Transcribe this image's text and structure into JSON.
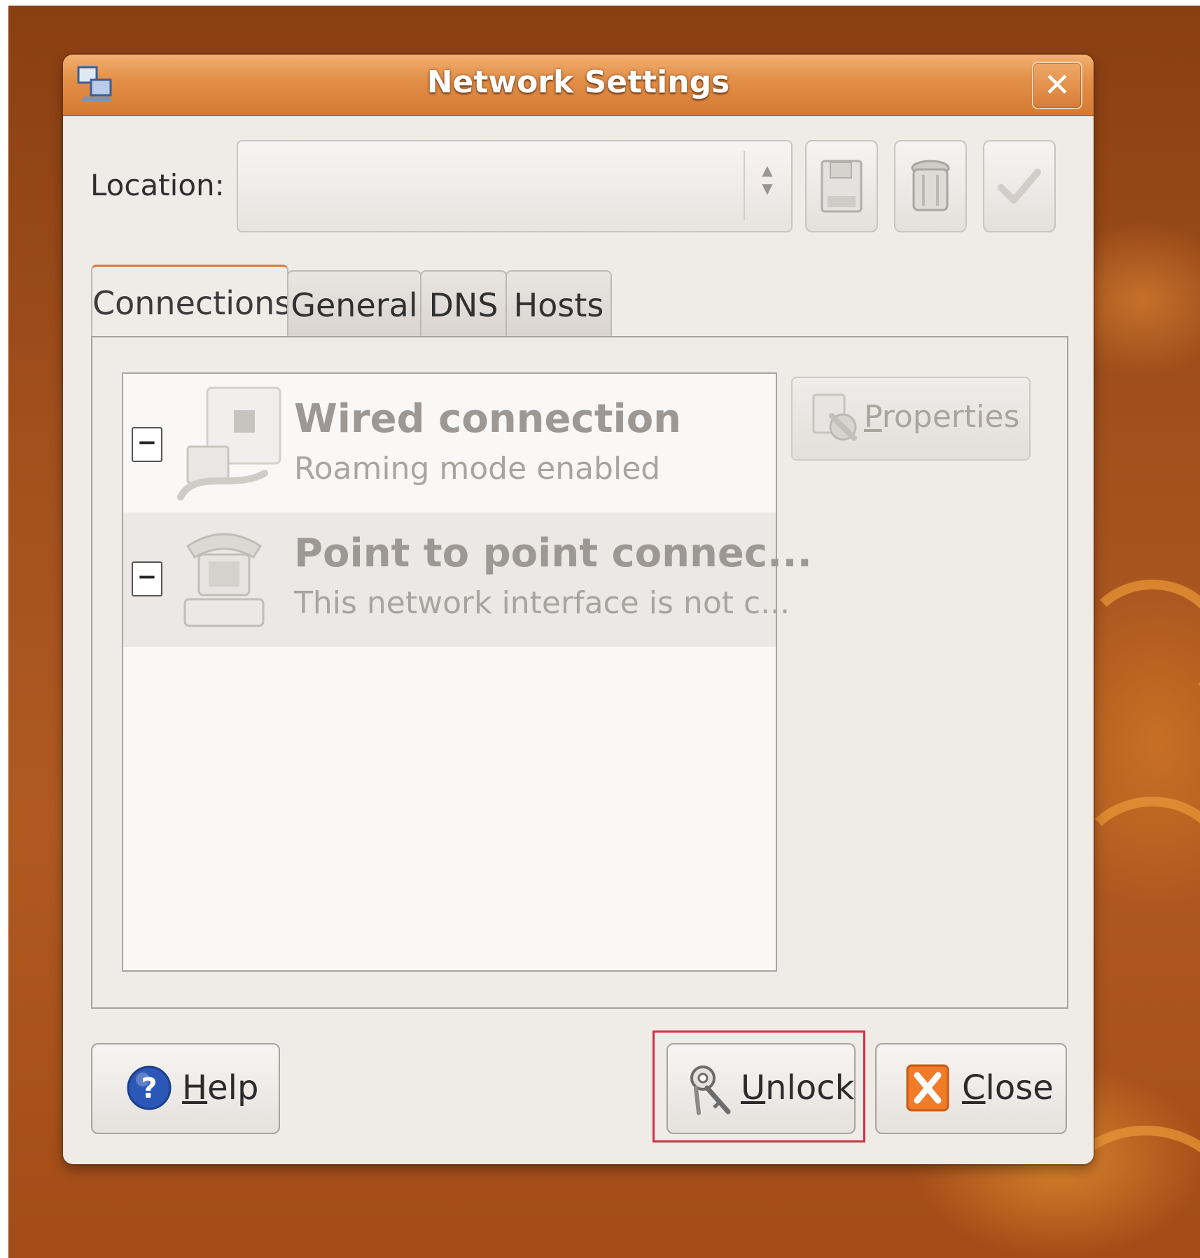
{
  "window": {
    "title": "Network Settings",
    "close_symbol": "✕"
  },
  "location": {
    "label": "Location:",
    "value": ""
  },
  "toolbar": {
    "icons": [
      "save-icon",
      "delete-icon",
      "apply-icon"
    ]
  },
  "tabs": [
    {
      "label": "Connections",
      "active": true
    },
    {
      "label": "General",
      "active": false
    },
    {
      "label": "DNS",
      "active": false
    },
    {
      "label": "Hosts",
      "active": false
    }
  ],
  "connections": [
    {
      "name": "Wired connection",
      "status": "Roaming mode enabled",
      "icon": "wired-network-icon",
      "expander": "−"
    },
    {
      "name": "Point to point connec...",
      "status": "This network interface is not c...",
      "icon": "telephone-modem-icon",
      "expander": "−"
    }
  ],
  "buttons": {
    "properties": {
      "mnemonic": "P",
      "rest": "roperties"
    },
    "help": {
      "mnemonic": "H",
      "rest": "elp"
    },
    "unlock": {
      "mnemonic": "U",
      "rest": "nlock"
    },
    "close": {
      "mnemonic": "C",
      "rest": "lose"
    }
  },
  "colors": {
    "titlebar_accent": "#e39049",
    "active_tab_accent": "#e07b2c",
    "highlight_border": "#d32f46"
  }
}
